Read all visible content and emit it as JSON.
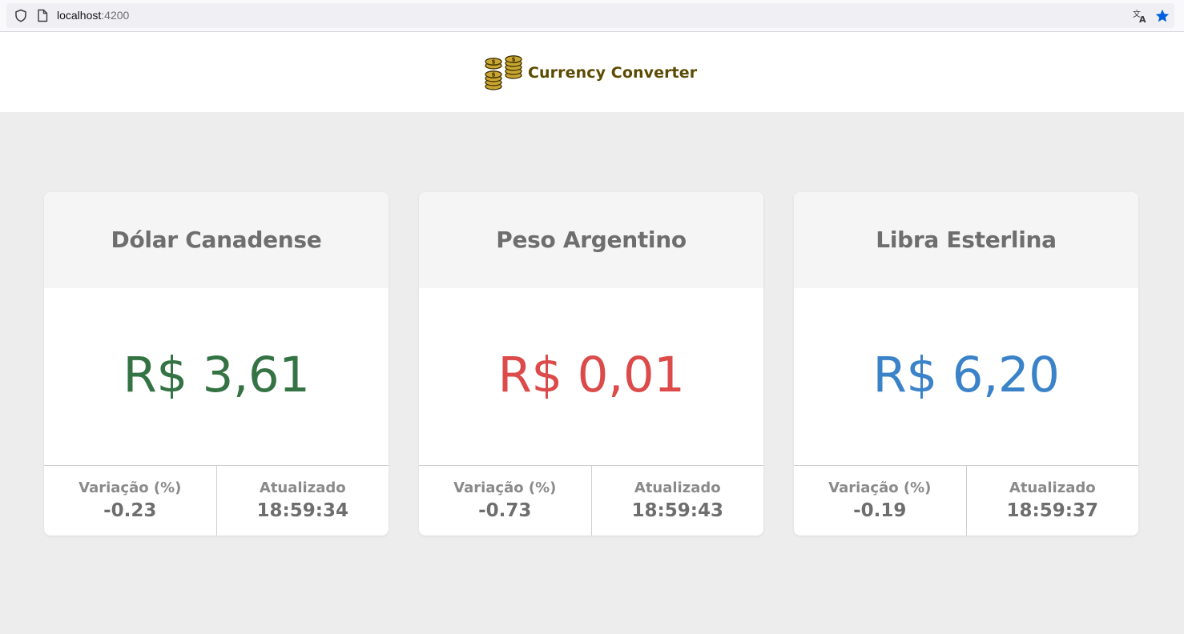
{
  "browser": {
    "url_host": "localhost",
    "url_port": ":4200"
  },
  "header": {
    "logo_icon": "coins-icon",
    "title": "Currency Converter",
    "title_color": "#5b4a02"
  },
  "cards": [
    {
      "currency": "Dólar Canadense",
      "price": "R$ 3,61",
      "price_color": "#347344",
      "variation_label": "Variação (%)",
      "variation": "-0.23",
      "updated_label": "Atualizado",
      "updated": "18:59:34"
    },
    {
      "currency": "Peso Argentino",
      "price": "R$ 0,01",
      "price_color": "#dc4a4a",
      "variation_label": "Variação (%)",
      "variation": "-0.73",
      "updated_label": "Atualizado",
      "updated": "18:59:43"
    },
    {
      "currency": "Libra Esterlina",
      "price": "R$ 6,20",
      "price_color": "#3b83c9",
      "variation_label": "Variação (%)",
      "variation": "-0.19",
      "updated_label": "Atualizado",
      "updated": "18:59:37"
    }
  ]
}
